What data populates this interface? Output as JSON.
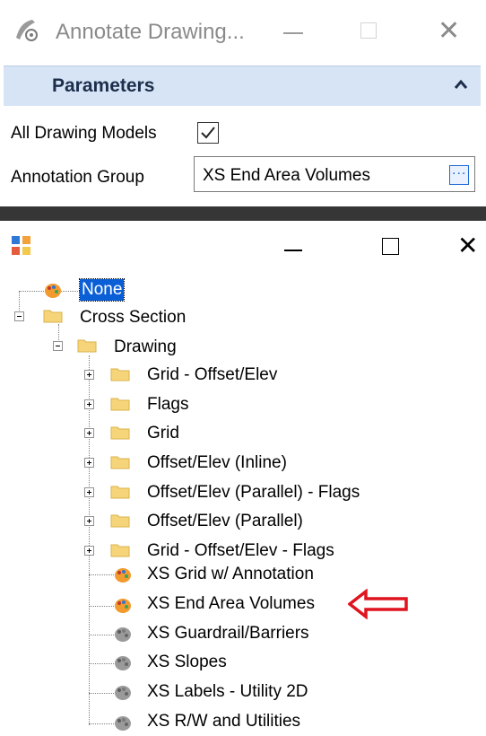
{
  "dialog": {
    "title": "Annotate Drawing...",
    "section_title": "Parameters",
    "all_drawing_models_label": "All Drawing Models",
    "all_drawing_models_checked": true,
    "annotation_group_label": "Annotation Group",
    "annotation_group_value": "XS End Area Volumes",
    "browse_label": "..."
  },
  "tree": {
    "items": [
      {
        "label": "None"
      },
      {
        "label": "Cross Section"
      },
      {
        "label": "Drawing"
      },
      {
        "label": "Grid - Offset/Elev"
      },
      {
        "label": "Flags"
      },
      {
        "label": "Grid"
      },
      {
        "label": "Offset/Elev (Inline)"
      },
      {
        "label": "Offset/Elev (Parallel) - Flags"
      },
      {
        "label": "Offset/Elev (Parallel)"
      },
      {
        "label": "Grid - Offset/Elev - Flags"
      },
      {
        "label": "XS Grid w/ Annotation"
      },
      {
        "label": "XS End Area Volumes"
      },
      {
        "label": "XS Guardrail/Barriers"
      },
      {
        "label": "XS Slopes"
      },
      {
        "label": "XS Labels - Utility 2D"
      },
      {
        "label": "XS R/W and Utilities"
      }
    ]
  },
  "colors": {
    "accent": "#0a5ed6",
    "params_bar": "#d6e4f6",
    "arrow": "#e0141e",
    "folder": "#f6d57a"
  }
}
